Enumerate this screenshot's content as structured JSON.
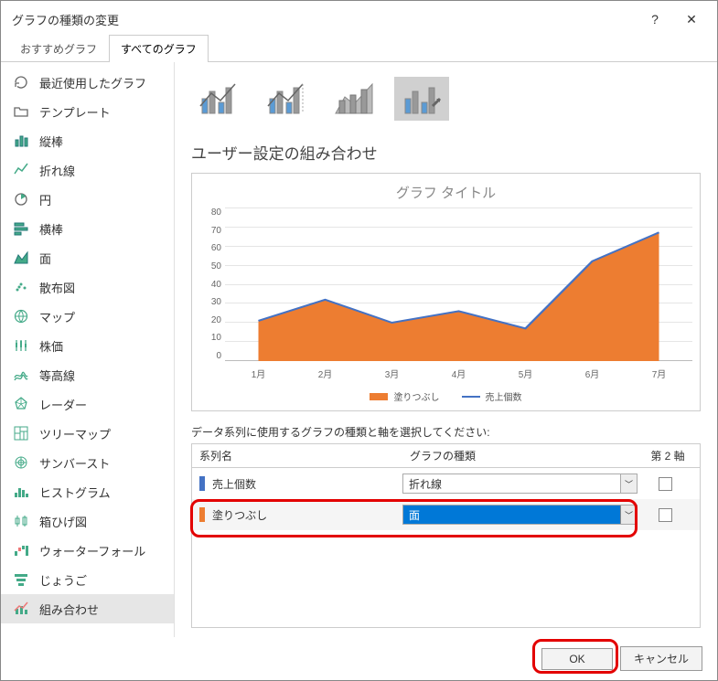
{
  "titlebar": {
    "title": "グラフの種類の変更"
  },
  "tabs": [
    {
      "label": "おすすめグラフ",
      "active": false
    },
    {
      "label": "すべてのグラフ",
      "active": true
    }
  ],
  "sidebar": {
    "items": [
      {
        "label": "最近使用したグラフ"
      },
      {
        "label": "テンプレート"
      },
      {
        "label": "縦棒"
      },
      {
        "label": "折れ線"
      },
      {
        "label": "円"
      },
      {
        "label": "横棒"
      },
      {
        "label": "面"
      },
      {
        "label": "散布図"
      },
      {
        "label": "マップ"
      },
      {
        "label": "株価"
      },
      {
        "label": "等高線"
      },
      {
        "label": "レーダー"
      },
      {
        "label": "ツリーマップ"
      },
      {
        "label": "サンバースト"
      },
      {
        "label": "ヒストグラム"
      },
      {
        "label": "箱ひげ図"
      },
      {
        "label": "ウォーターフォール"
      },
      {
        "label": "じょうご"
      },
      {
        "label": "組み合わせ"
      }
    ],
    "selected_index": 18
  },
  "section_heading": "ユーザー設定の組み合わせ",
  "chart_data": {
    "type": "combo",
    "title": "グラフ タイトル",
    "categories": [
      "1月",
      "2月",
      "3月",
      "4月",
      "5月",
      "6月",
      "7月"
    ],
    "series": [
      {
        "name": "塗りつぶし",
        "type": "area",
        "color": "#ed7d31",
        "values": [
          21,
          32,
          20,
          26,
          17,
          52,
          67
        ]
      },
      {
        "name": "売上個数",
        "type": "line",
        "color": "#4472c4",
        "values": [
          21,
          32,
          20,
          26,
          17,
          52,
          67
        ]
      }
    ],
    "ylim": [
      0,
      80
    ],
    "yticks": [
      0,
      10,
      20,
      30,
      40,
      50,
      60,
      70,
      80
    ],
    "legend": [
      "塗りつぶし",
      "売上個数"
    ]
  },
  "xlabels": [
    "1月",
    "2月",
    "3月",
    "4月",
    "5月",
    "6月",
    "7月"
  ],
  "ylabels": [
    "80",
    "70",
    "60",
    "50",
    "40",
    "30",
    "20",
    "10",
    "0"
  ],
  "series_instruction": "データ系列に使用するグラフの種類と軸を選択してください:",
  "series_table": {
    "headers": {
      "name": "系列名",
      "type": "グラフの種類",
      "axis": "第 2 軸"
    },
    "rows": [
      {
        "color": "#4472c4",
        "name": "売上個数",
        "type": "折れ線",
        "axis2": false,
        "selected": false
      },
      {
        "color": "#ed7d31",
        "name": "塗りつぶし",
        "type": "面",
        "axis2": false,
        "selected": true
      }
    ]
  },
  "footer": {
    "ok": "OK",
    "cancel": "キャンセル"
  }
}
